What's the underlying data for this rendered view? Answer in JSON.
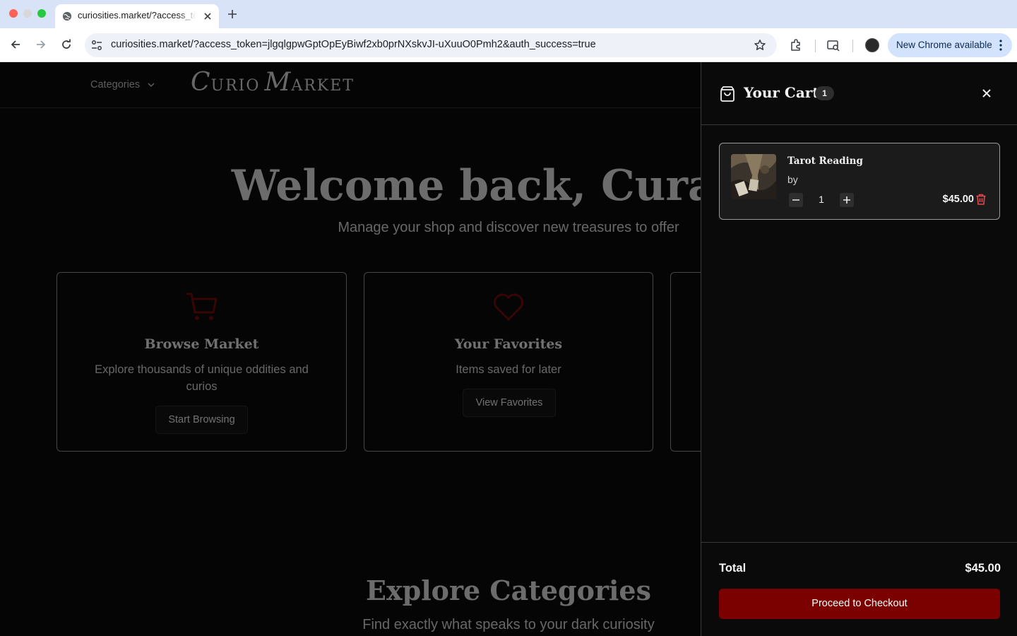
{
  "browser": {
    "tab_title": "curiosities.market/?access_token=jlgqlgpwGptOpEyBiwf2xb0prNXskvJI-uXuuO0Pmh2&auth_success=true",
    "url": "curiosities.market/?access_token=jlgqlgpwGptOpEyBiwf2xb0prNXskvJI-uXuuO0Pmh2&auth_success=true",
    "update_label": "New Chrome available"
  },
  "header": {
    "categories_label": "Categories",
    "logo_c": "C",
    "logo_urio": "URIO",
    "logo_m": "M",
    "logo_arket": "ARKET"
  },
  "hero": {
    "title": "Welcome back, Curator",
    "subtitle": "Manage your shop and discover new treasures to offer"
  },
  "cards": [
    {
      "icon": "cart-icon",
      "title": "Browse Market",
      "description": "Explore thousands of unique oddities and curios",
      "button": "Start Browsing"
    },
    {
      "icon": "heart-icon",
      "title": "Your Favorites",
      "description": "Items saved for later",
      "button": "View Favorites"
    }
  ],
  "explore": {
    "title": "Explore Categories",
    "subtitle": "Find exactly what speaks to your dark curiosity"
  },
  "cart": {
    "title": "Your Cart",
    "count": "1",
    "items": [
      {
        "name": "Tarot Reading",
        "by": "by",
        "quantity": "1",
        "price": "$45.00"
      }
    ],
    "total_label": "Total",
    "total_value": "$45.00",
    "checkout_label": "Proceed to Checkout"
  },
  "colors": {
    "accent": "#7b0000",
    "icon_red": "#6e0a0a",
    "trash_red": "#e5484d"
  }
}
